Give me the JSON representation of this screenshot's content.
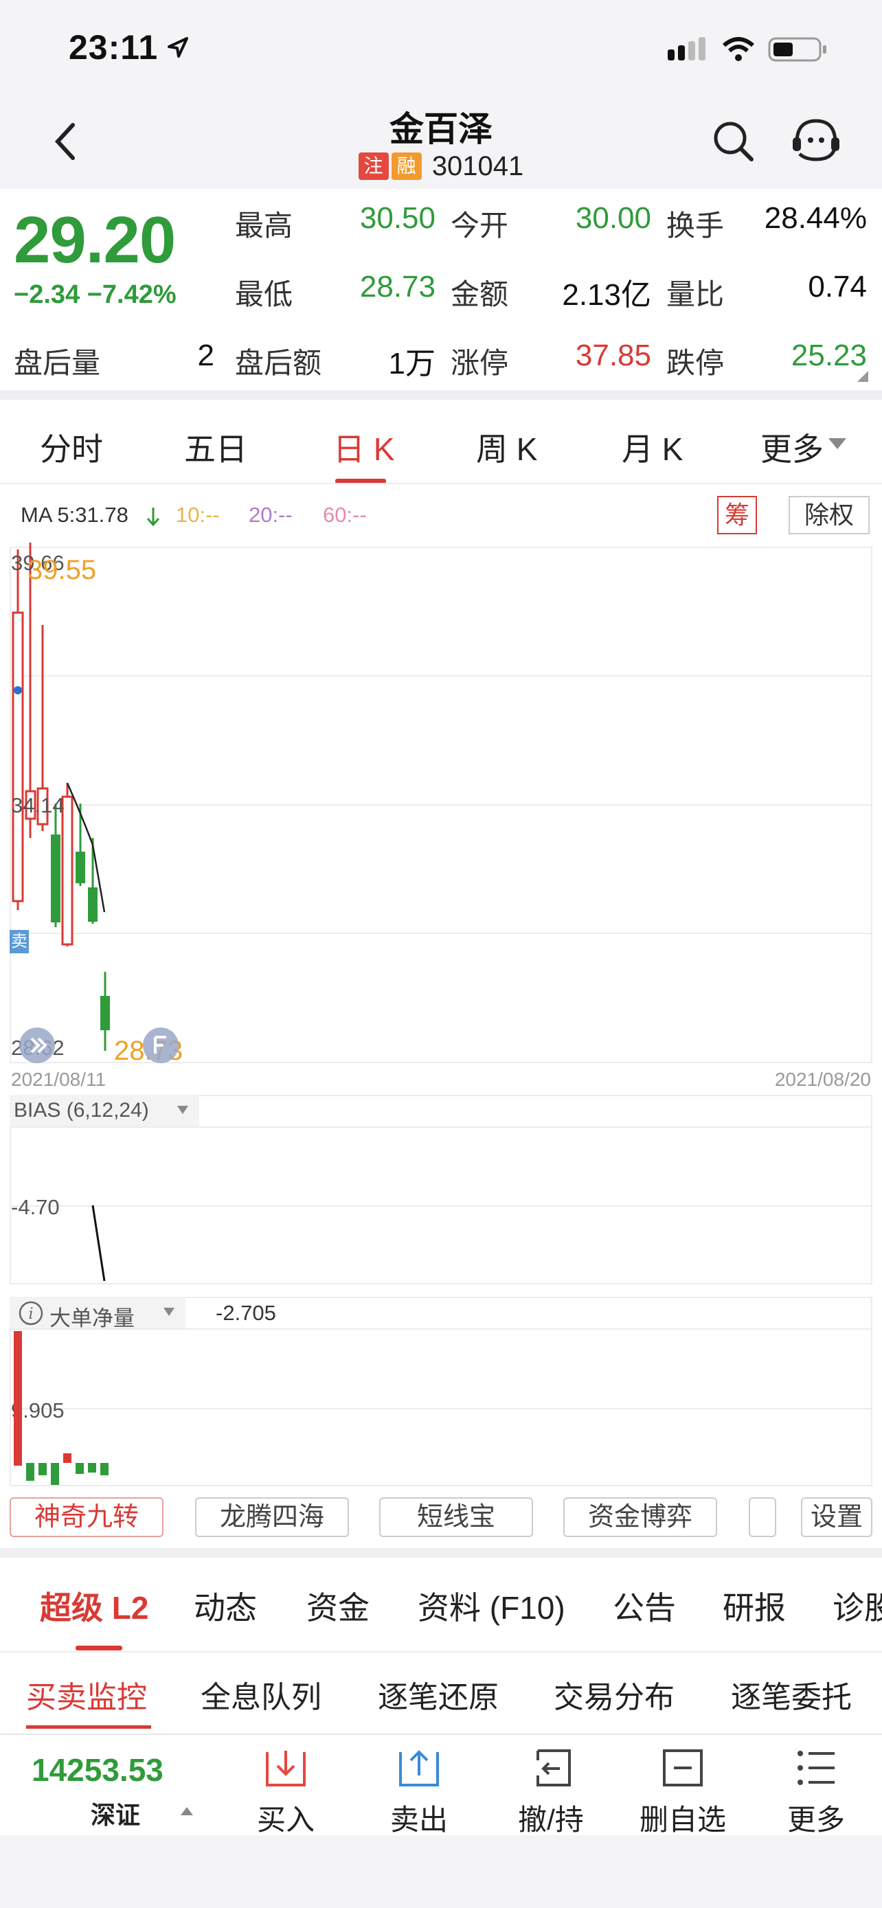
{
  "status": {
    "time": "23:11"
  },
  "header": {
    "title": "金百泽",
    "tag1": "注",
    "tag2": "融",
    "code": "301041"
  },
  "quote": {
    "price": "29.20",
    "change": "−2.34  −7.42%",
    "stats": [
      {
        "label": "最高",
        "value": "30.50",
        "color": "green"
      },
      {
        "label": "今开",
        "value": "30.00",
        "color": "green"
      },
      {
        "label": "换手",
        "value": "28.44%",
        "color": "black"
      },
      {
        "label": "最低",
        "value": "28.73",
        "color": "green"
      },
      {
        "label": "金额",
        "value": "2.13亿",
        "color": "black"
      },
      {
        "label": "量比",
        "value": "0.74",
        "color": "black"
      },
      {
        "label": "盘后量",
        "value": "2",
        "color": "black"
      },
      {
        "label": "盘后额",
        "value": "1万",
        "color": "black"
      },
      {
        "label": "涨停",
        "value": "37.85",
        "color": "red"
      },
      {
        "label": "跌停",
        "value": "25.23",
        "color": "green"
      }
    ]
  },
  "period_tabs": [
    "分时",
    "五日",
    "日 K",
    "周 K",
    "月 K",
    "更多"
  ],
  "chart": {
    "ma_label": "MA 5:31.78",
    "ma10": "10:--",
    "ma20": "20:--",
    "ma60": "60:--",
    "chip_button": "筹",
    "exright_button": "除权",
    "y_top": "39.66",
    "y_mid": "34.14",
    "y_low": "28.62",
    "high_mark": "39.55",
    "low_mark": "28.73",
    "sell_tag": "卖",
    "date_start": "2021/08/11",
    "date_end": "2021/08/20",
    "bias_label": "BIAS (6,12,24)",
    "bias_value": "-4.70",
    "flow_label": "大单净量",
    "flow_value": "-2.705",
    "flow_axis": "9.905"
  },
  "tool_buttons": [
    "神奇九转",
    "龙腾四海",
    "短线宝",
    "资金博弈",
    "设置"
  ],
  "bottom_tabs": [
    "超级 L2",
    "动态",
    "资金",
    "资料 (F10)",
    "公告",
    "研报",
    "诊股"
  ],
  "sub_tabs": [
    "买卖监控",
    "全息队列",
    "逐笔还原",
    "交易分布",
    "逐笔委托"
  ],
  "footer": {
    "index_value": "14253.53",
    "index_name": "深证",
    "buy": "买入",
    "sell": "卖出",
    "cancel": "撤/持",
    "remove": "删自选",
    "more": "更多"
  },
  "colors": {
    "up": "#d93a35",
    "down": "#2f9b3a",
    "accent": "#d93a35"
  }
}
